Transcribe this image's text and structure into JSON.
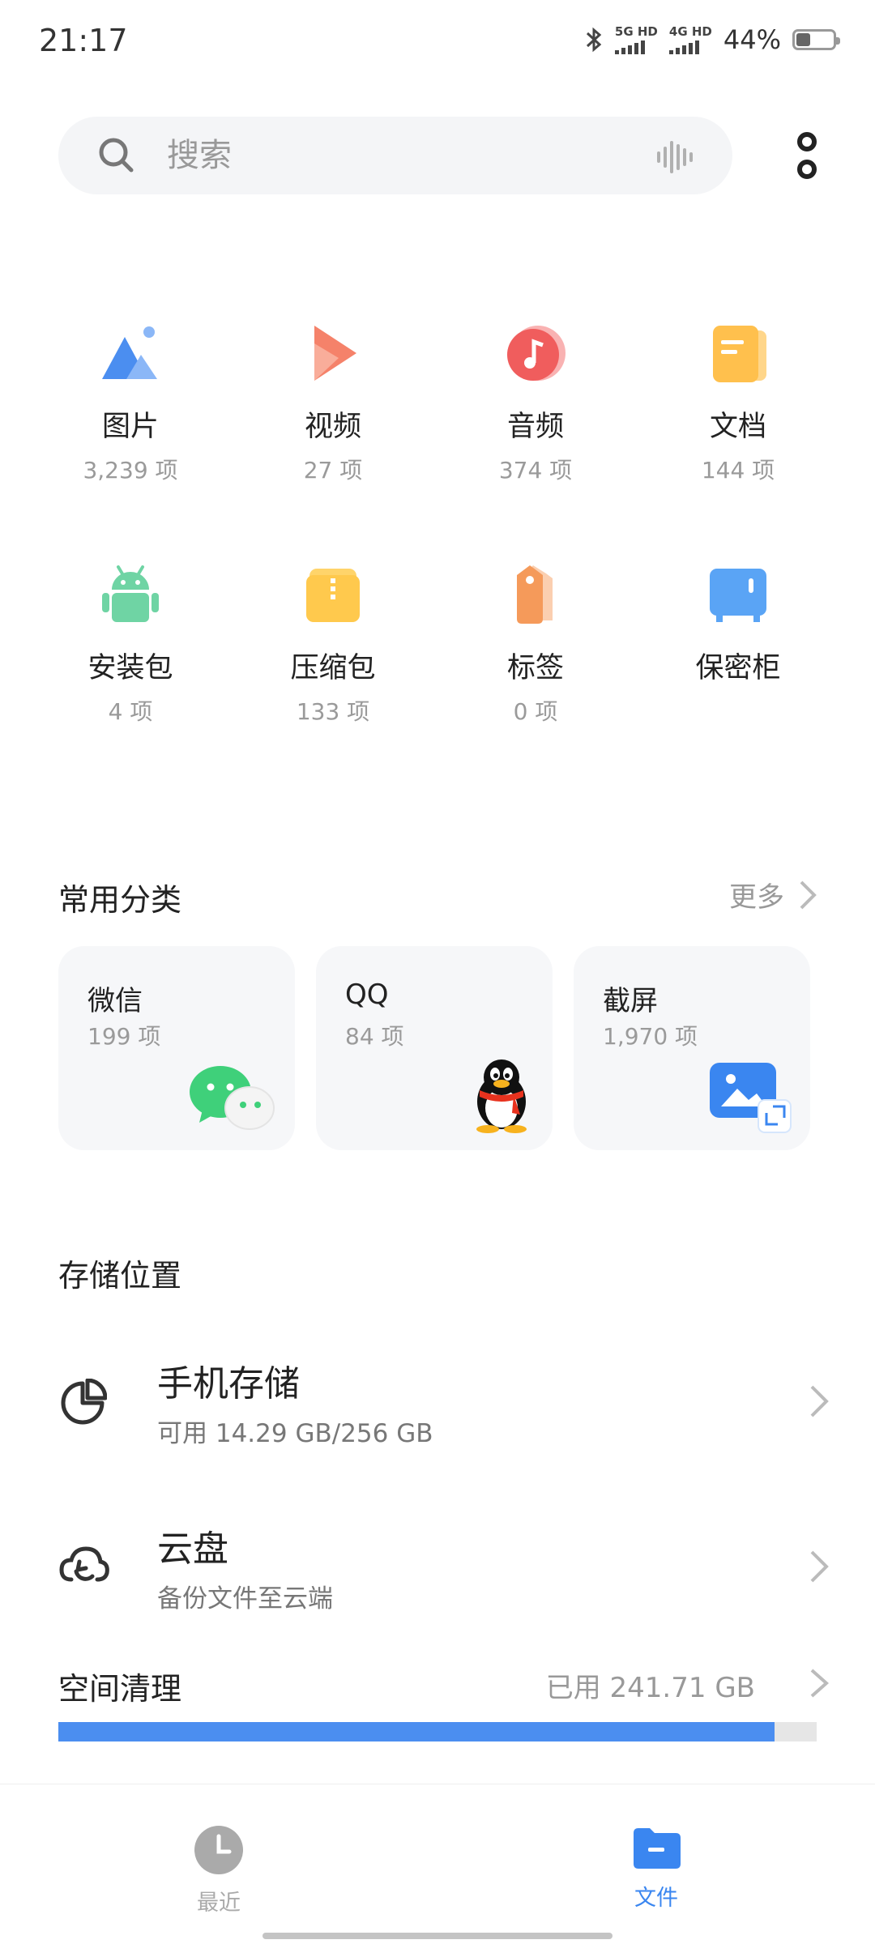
{
  "status": {
    "time": "21:17",
    "sim1": "5G HD",
    "sim2": "4G HD",
    "battery_text": "44%",
    "battery_level": 0.44
  },
  "search": {
    "placeholder": "搜索"
  },
  "categories": [
    {
      "name": "图片",
      "count": "3,239 项",
      "icon": "image-icon"
    },
    {
      "name": "视频",
      "count": "27 项",
      "icon": "video-icon"
    },
    {
      "name": "音频",
      "count": "374 项",
      "icon": "audio-icon"
    },
    {
      "name": "文档",
      "count": "144 项",
      "icon": "document-icon"
    },
    {
      "name": "安装包",
      "count": "4 项",
      "icon": "android-icon"
    },
    {
      "name": "压缩包",
      "count": "133 项",
      "icon": "archive-icon"
    },
    {
      "name": "标签",
      "count": "0 项",
      "icon": "tag-icon"
    },
    {
      "name": "保密柜",
      "count": "",
      "icon": "safe-icon"
    }
  ],
  "common": {
    "title": "常用分类",
    "more": "更多",
    "cards": [
      {
        "title": "微信",
        "count": "199 项",
        "icon": "wechat-icon"
      },
      {
        "title": "QQ",
        "count": "84 项",
        "icon": "qq-penguin-icon"
      },
      {
        "title": "截屏",
        "count": "1,970 项",
        "icon": "screenshot-icon"
      }
    ]
  },
  "storage": {
    "title": "存储位置",
    "phone": {
      "title": "手机存储",
      "sub": "可用 14.29 GB/256 GB"
    },
    "cloud": {
      "title": "云盘",
      "sub": "备份文件至云端"
    }
  },
  "cleanup": {
    "title": "空间清理",
    "used": "已用 241.71 GB",
    "used_fraction": 0.944
  },
  "nav": {
    "recent": "最近",
    "files": "文件",
    "active_color": "#3a86f0",
    "inactive_color": "#aaaaaa"
  },
  "colors": {
    "accent": "#4b8ef0"
  }
}
